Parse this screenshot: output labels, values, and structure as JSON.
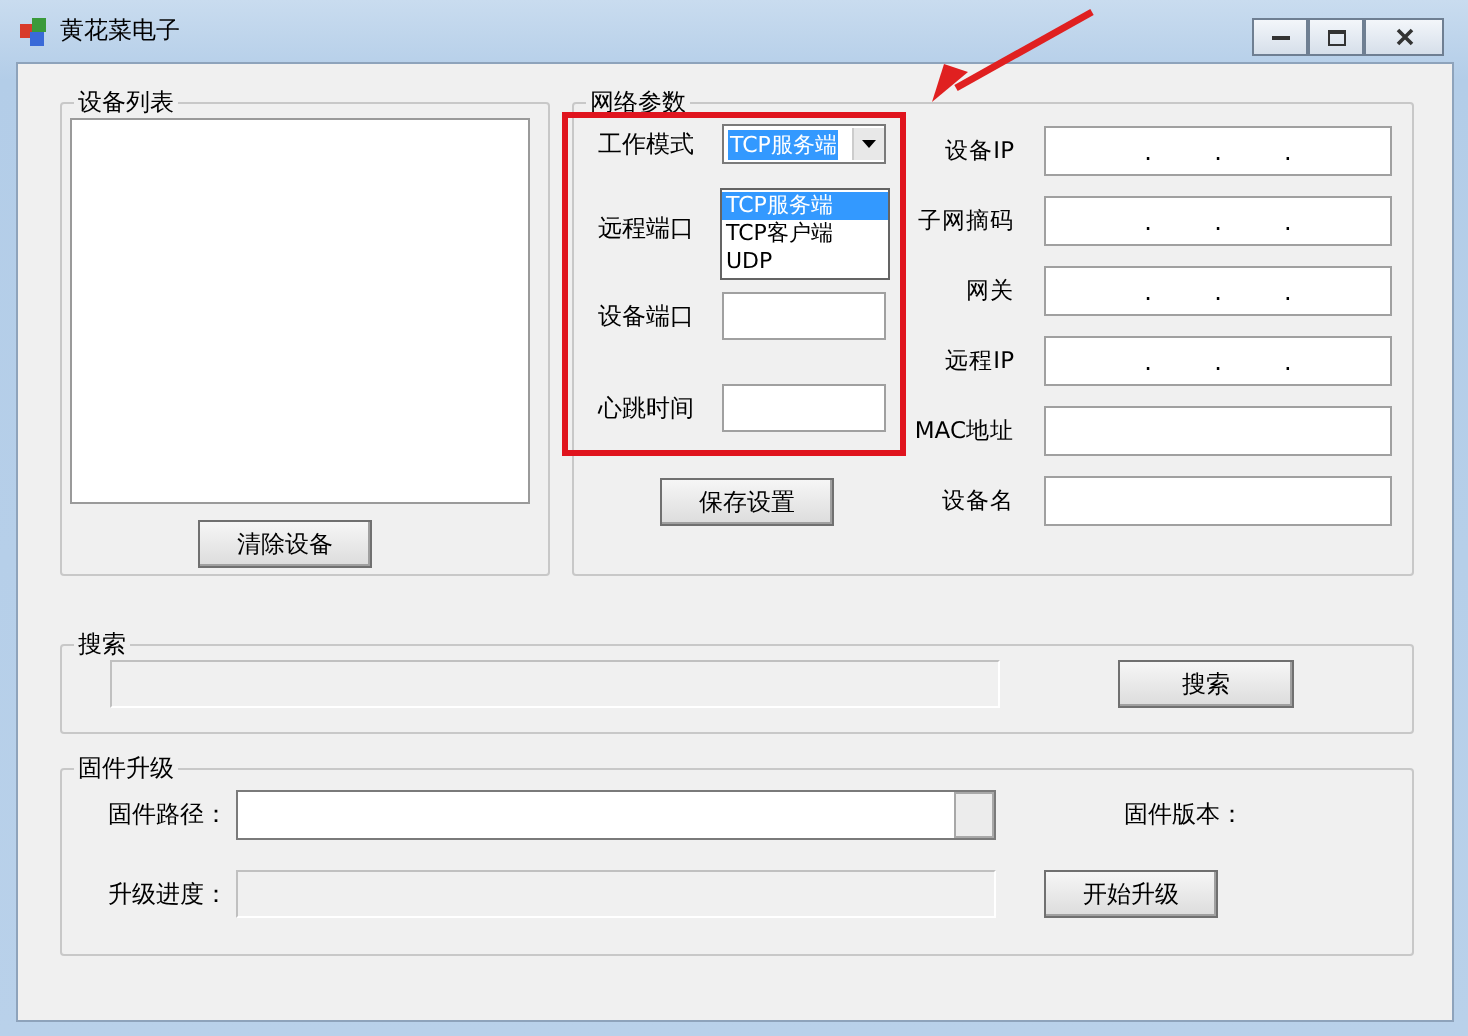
{
  "window": {
    "title": "黄花菜电子"
  },
  "device_list": {
    "title": "设备列表",
    "clear_button": "清除设备"
  },
  "network": {
    "title": "网络参数",
    "left_rows": [
      {
        "label": "工作模式",
        "kind": "combo",
        "value": "TCP服务端"
      },
      {
        "label": "远程端口",
        "kind": "covered"
      },
      {
        "label": "设备端口",
        "kind": "text"
      },
      {
        "label": "心跳时间",
        "kind": "text"
      }
    ],
    "dropdown": {
      "options": [
        {
          "label": "TCP服务端",
          "selected": true
        },
        {
          "label": "TCP客户端",
          "selected": false
        },
        {
          "label": "UDP",
          "selected": false
        }
      ]
    },
    "save_button": "保存设置",
    "right_rows": [
      {
        "label": "设备IP",
        "kind": "ip",
        "separators": [
          ".",
          ".",
          "."
        ]
      },
      {
        "label": "子网摘码",
        "kind": "ip",
        "separators": [
          ".",
          ".",
          "."
        ]
      },
      {
        "label": "网关",
        "kind": "ip",
        "separators": [
          ".",
          ".",
          "."
        ]
      },
      {
        "label": "远程IP",
        "kind": "ip",
        "separators": [
          ".",
          ".",
          "."
        ]
      },
      {
        "label": "MAC地址",
        "kind": "text"
      },
      {
        "label": "设备名",
        "kind": "text"
      }
    ]
  },
  "search": {
    "title": "搜索",
    "button": "搜索",
    "progress": {
      "level": 0
    }
  },
  "firmware": {
    "title": "固件升级",
    "path_label": "固件路径：",
    "version_label": "固件版本：",
    "progress_label": "升级进度：",
    "progress": {
      "level": 0
    },
    "start_button": "开始升级"
  }
}
